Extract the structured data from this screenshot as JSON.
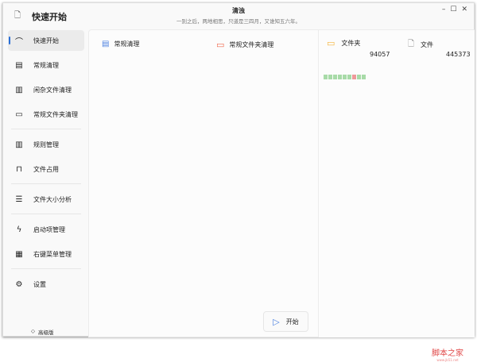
{
  "window": {
    "title": "快速开始",
    "header_title": "清浊",
    "header_subtitle": "一别之后，两地相思，只道是三四月，又谁知五六年。",
    "controls": [
      "–",
      "☐",
      "✕"
    ]
  },
  "sidebar": {
    "items": [
      {
        "label": "快速开始",
        "icon": "gauge-icon",
        "glyph": "⌒"
      },
      {
        "label": "常规清理",
        "icon": "list-box-icon",
        "glyph": "▤"
      },
      {
        "label": "闲杂文件清理",
        "icon": "chart-file-icon",
        "glyph": "▥"
      },
      {
        "label": "常规文件夹清理",
        "icon": "folder-icon",
        "glyph": "▭"
      },
      {
        "label": "规则管理",
        "icon": "rules-icon",
        "glyph": "▥"
      },
      {
        "label": "文件占用",
        "icon": "lock-icon",
        "glyph": "⊓"
      },
      {
        "label": "文件大小分析",
        "icon": "list-icon",
        "glyph": "☰"
      },
      {
        "label": "启动项管理",
        "icon": "lightning-icon",
        "glyph": "ϟ"
      },
      {
        "label": "右键菜单管理",
        "icon": "calculator-icon",
        "glyph": "▦"
      },
      {
        "label": "设置",
        "icon": "gear-icon",
        "glyph": "⚙"
      }
    ],
    "footer": "高级版"
  },
  "main": {
    "options": [
      {
        "label": "常规清理",
        "color": "#4a7fe0"
      },
      {
        "label": "常规文件夹清理",
        "color": "#f06a4f"
      }
    ],
    "start_label": "开始"
  },
  "stats": {
    "folders_label": "文件夹",
    "folders_count": "94057",
    "files_label": "文件",
    "files_count": "445373",
    "blocks": [
      "ok",
      "ok",
      "ok",
      "ok",
      "ok",
      "ok",
      "bad",
      "ok",
      "ok"
    ]
  },
  "watermark": {
    "text": "脚本之家",
    "url": "www.jb51.net"
  }
}
